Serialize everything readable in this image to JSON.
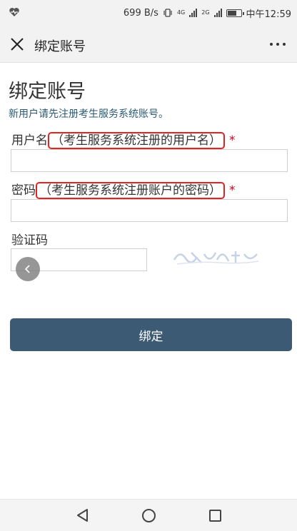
{
  "status_bar": {
    "net_speed": "699 B/s",
    "network_1": "4G",
    "network_2": "2G",
    "time": "中午12:59",
    "battery_level": 0.55
  },
  "title_bar": {
    "title": "绑定账号"
  },
  "form": {
    "heading": "绑定账号",
    "notice": "新用户请先注册考生服务系统账号。",
    "username": {
      "label": "用户名",
      "hint": "（考生服务系统注册的用户名）",
      "required_mark": "*",
      "value": ""
    },
    "password": {
      "label": "密码",
      "hint": "（考生服务系统注册账户的密码）",
      "required_mark": "*",
      "value": ""
    },
    "captcha": {
      "label": "验证码",
      "value": ""
    },
    "submit_label": "绑定"
  },
  "colors": {
    "button": "#3d5a74",
    "highlight_border": "#e02424",
    "required": "#d0021b",
    "notice": "#2a5b72"
  }
}
